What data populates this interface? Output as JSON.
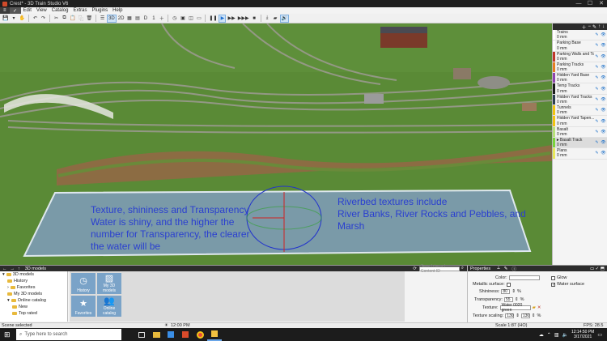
{
  "window": {
    "title": "Crest* - 3D Train Studio V6",
    "minimize": "—",
    "maximize": "☐",
    "close": "✕"
  },
  "menu": {
    "file_tab": "≡",
    "settings_tab": "✓",
    "items": [
      "Edit",
      "View",
      "Catalog",
      "Extras",
      "Plugins",
      "Help"
    ]
  },
  "toolbar": {
    "view3d": "3D",
    "view2d": "2D",
    "layer_button": "D",
    "layer_value": "1",
    "pause": "❚❚",
    "play": "▶",
    "ff": "▶▶",
    "fff": "▶▶▶",
    "stop": "■"
  },
  "viewport": {
    "annotation_left": [
      "Texture, shininess and Transparency",
      "Water is shiny, and the higher the",
      "number for Transparency, the clearer",
      "the water will be"
    ],
    "annotation_right": [
      "Riverbed textures include",
      "River Banks, River Rocks and Pebbles, and",
      "Marsh"
    ]
  },
  "layers": [
    {
      "name": "Trains",
      "height": "0 mm",
      "color": "#ffffff"
    },
    {
      "name": "Parking Base",
      "height": "0 mm",
      "color": "#ffffff"
    },
    {
      "name": "Parking Walls and Top",
      "height": "0 mm",
      "color": "#c0392b"
    },
    {
      "name": "Parking Tracks",
      "height": "0 mm",
      "color": "#e67e22"
    },
    {
      "name": "Hidden Yard Base",
      "height": "0 mm",
      "color": "#8e44ad"
    },
    {
      "name": "Temp Tracks",
      "height": "0 mm",
      "color": "#1a1a1a"
    },
    {
      "name": "Hidden Yard Tracks",
      "height": "0 mm",
      "color": "#2c3e50"
    },
    {
      "name": "Tunnels",
      "height": "0 mm",
      "color": "#f1c40f"
    },
    {
      "name": "Hidden Yard Tapen...",
      "height": "0 mm",
      "color": "#f1c40f"
    },
    {
      "name": "Basalt",
      "height": "0 mm",
      "color": "#b8e07a"
    },
    {
      "name": "Basalt Track",
      "height": "0 mm",
      "color": "#7bd33a",
      "selected": true
    },
    {
      "name": "Plans",
      "height": "0 mm",
      "color": "#e8e85a"
    }
  ],
  "library": {
    "header": "3D models",
    "search_placeholder": "Search term / Content ID",
    "tree": [
      "3D models",
      "History",
      "Favorites",
      "My 3D models",
      "Online catalog",
      "New",
      "Top rated"
    ],
    "tiles": [
      "History",
      "My 3D models",
      "Favorites",
      "Online catalog"
    ]
  },
  "properties": {
    "header": "Properties",
    "color_label": "Color:",
    "metallic_label": "Metallic surface:",
    "shininess_label": "Shininess:",
    "shininess_value": "80",
    "shininess_unit": "%",
    "transparency_label": "Transparency:",
    "transparency_value": "55",
    "transparency_unit": "%",
    "texture_label": "Texture:",
    "texture_value": "Water 0020 green",
    "scaling_label": "Texture scaling:",
    "scaling_x": "130",
    "scaling_y": "130",
    "scaling_unit": "%",
    "glow_label": "Glow",
    "water_surface_label": "Water surface"
  },
  "status": {
    "left": "Scene selected",
    "time": "12:00 PM",
    "scale": "Scale 1:87 (HO)",
    "fps": "FPS: 28.5"
  },
  "taskbar": {
    "search_placeholder": "Type here to search",
    "clock_time": "12:14:50 PM",
    "clock_date": "3/17/2021"
  }
}
